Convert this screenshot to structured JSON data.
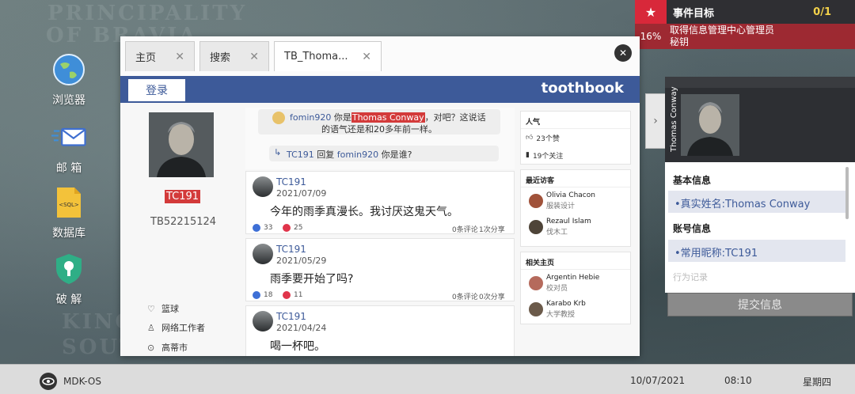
{
  "desktop": {
    "icons": [
      {
        "label": "浏览器"
      },
      {
        "label": "邮 箱"
      },
      {
        "label": "数据库",
        "glyph": "<SQL>"
      },
      {
        "label": "破 解"
      }
    ],
    "map_labels": [
      "PRINCIPALITY",
      "OF BRAVIA",
      "KING",
      "SOUTH"
    ]
  },
  "objective": {
    "title": "事件目标",
    "count": "0/1",
    "percent": "16%",
    "task_line1": "取得信息管理中心管理员",
    "task_line2": "秘钥"
  },
  "browser": {
    "tabs": [
      {
        "label": "主页"
      },
      {
        "label": "搜索"
      },
      {
        "label": "TB_Thoma..."
      }
    ],
    "login_label": "登录",
    "brand": "toothbook",
    "profile": {
      "username": "TC191",
      "user_id": "TB52215124",
      "details": [
        {
          "icon": "heart-icon",
          "text": "篮球"
        },
        {
          "icon": "tie-icon",
          "text": "网络工作者"
        },
        {
          "icon": "location-icon",
          "text": "高蒂市"
        }
      ]
    },
    "comment": {
      "author": "fomin920",
      "before": "你是",
      "highlight": "Thomas Conway",
      "after": "，对吧？这说话",
      "line2": "的语气还是和20多年前一样。"
    },
    "reply": {
      "author": "TC191",
      "verb": "回复",
      "target": "fomin920",
      "text": "你是谁?"
    },
    "posts": [
      {
        "name": "TC191",
        "date": "2021/07/09",
        "text": "今年的雨季真漫长。我讨厌这鬼天气。",
        "likes": "33",
        "hearts": "25",
        "comments": "0条评论",
        "shares": "1次分享"
      },
      {
        "name": "TC191",
        "date": "2021/05/29",
        "text": "雨季要开始了吗?",
        "likes": "18",
        "hearts": "11",
        "comments": "0条评论",
        "shares": "0次分享"
      },
      {
        "name": "TC191",
        "date": "2021/04/24",
        "text": "喝一杯吧。"
      }
    ],
    "sidebar": {
      "popularity": {
        "title": "人气",
        "likes": "23个赞",
        "follows": "19个关注"
      },
      "visitors": {
        "title": "最近访客",
        "people": [
          {
            "name": "Olivia Chacon",
            "role": "服装设计"
          },
          {
            "name": "Rezaul Islam",
            "role": "伐木工"
          }
        ]
      },
      "related": {
        "title": "相关主页",
        "people": [
          {
            "name": "Argentin Hebie",
            "role": "校对员"
          },
          {
            "name": "Karabo Krb",
            "role": "大学教授"
          }
        ]
      }
    }
  },
  "info_panel": {
    "vertical_name": "Thomas Conway",
    "basic_title": "基本信息",
    "real_name": "•真实姓名:Thomas Conway",
    "account_title": "账号信息",
    "nickname": "•常用昵称:TC191",
    "faded": "行为记录",
    "submit_label": "提交信息"
  },
  "taskbar": {
    "os_name": "MDK-OS",
    "date": "10/07/2021",
    "time": "08:10",
    "weekday": "星期四"
  },
  "colors": {
    "accent": "#3d5a99",
    "alert": "#d33a3a",
    "objective_bg": "#2f2f33"
  }
}
